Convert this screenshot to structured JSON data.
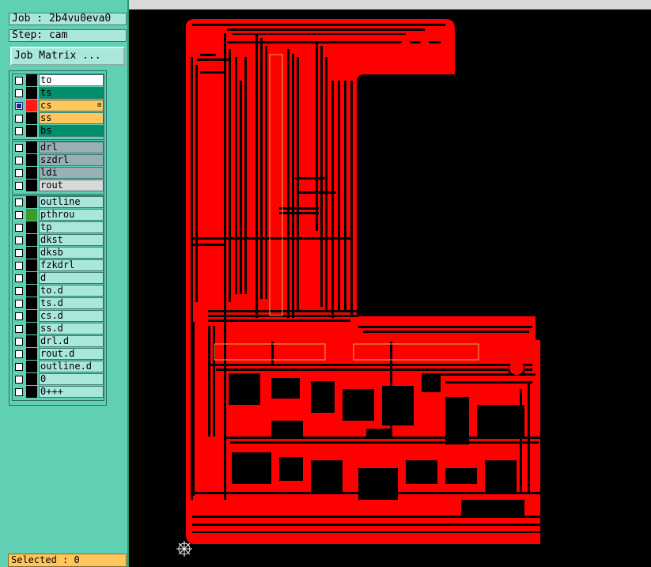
{
  "job": {
    "label": "Job : 2b4vu0eva0"
  },
  "step": {
    "label": "Step: cam"
  },
  "job_matrix_button": "Job Matrix ...",
  "layer_groups": [
    {
      "name": "board-layers",
      "layers": [
        {
          "name": "to",
          "color": "#ffffff",
          "checked": false,
          "swatch": "#000000"
        },
        {
          "name": "ts",
          "color": "#008f6b",
          "checked": false,
          "swatch": "#000000"
        },
        {
          "name": "cs",
          "color": "#ffc65c",
          "checked": true,
          "swatch": "#ff1a1a",
          "plus": "⊞"
        },
        {
          "name": "ss",
          "color": "#ffc65c",
          "checked": false,
          "swatch": "#000000"
        },
        {
          "name": "bs",
          "color": "#008f6b",
          "checked": false,
          "swatch": "#000000"
        }
      ]
    },
    {
      "name": "drill-layers",
      "layers": [
        {
          "name": "drl",
          "color": "#9aaeb6",
          "checked": false,
          "swatch": "#000000"
        },
        {
          "name": "szdrl",
          "color": "#9aaeb6",
          "checked": false,
          "swatch": "#000000"
        },
        {
          "name": "ldi",
          "color": "#9aaeb6",
          "checked": false,
          "swatch": "#000000"
        },
        {
          "name": "rout",
          "color": "#d9d9d9",
          "checked": false,
          "swatch": "#000000"
        }
      ]
    },
    {
      "name": "misc-layers",
      "layers": [
        {
          "name": "outline",
          "color": "#a9e6dc",
          "checked": false,
          "swatch": "#000000"
        },
        {
          "name": "pthrou",
          "color": "#a9e6dc",
          "checked": false,
          "swatch": "#3a9a2a"
        },
        {
          "name": "tp",
          "color": "#a9e6dc",
          "checked": false,
          "swatch": "#000000"
        },
        {
          "name": "dkst",
          "color": "#a9e6dc",
          "checked": false,
          "swatch": "#000000"
        },
        {
          "name": "dksb",
          "color": "#a9e6dc",
          "checked": false,
          "swatch": "#000000"
        },
        {
          "name": "fzkdrl",
          "color": "#a9e6dc",
          "checked": false,
          "swatch": "#000000"
        },
        {
          "name": "d",
          "color": "#a9e6dc",
          "checked": false,
          "swatch": "#000000"
        },
        {
          "name": "to.d",
          "color": "#a9e6dc",
          "checked": false,
          "swatch": "#000000"
        },
        {
          "name": "ts.d",
          "color": "#a9e6dc",
          "checked": false,
          "swatch": "#000000"
        },
        {
          "name": "cs.d",
          "color": "#a9e6dc",
          "checked": false,
          "swatch": "#000000"
        },
        {
          "name": "ss.d",
          "color": "#a9e6dc",
          "checked": false,
          "swatch": "#000000"
        },
        {
          "name": "drl.d",
          "color": "#a9e6dc",
          "checked": false,
          "swatch": "#000000"
        },
        {
          "name": "rout.d",
          "color": "#a9e6dc",
          "checked": false,
          "swatch": "#000000"
        },
        {
          "name": "outline.d",
          "color": "#a9e6dc",
          "checked": false,
          "swatch": "#000000"
        },
        {
          "name": "0",
          "color": "#a9e6dc",
          "checked": false,
          "swatch": "#000000"
        },
        {
          "name": "0+++",
          "color": "#a9e6dc",
          "checked": false,
          "swatch": "#000000"
        }
      ]
    }
  ],
  "status": {
    "selected": "Selected : 0"
  },
  "colors": {
    "copper": "#ff0000",
    "background": "#000000",
    "panel": "#5fd0b4",
    "profile_outline": "#d9b24a"
  },
  "icons": {
    "origin_marker": "crosshair-origin-icon"
  }
}
